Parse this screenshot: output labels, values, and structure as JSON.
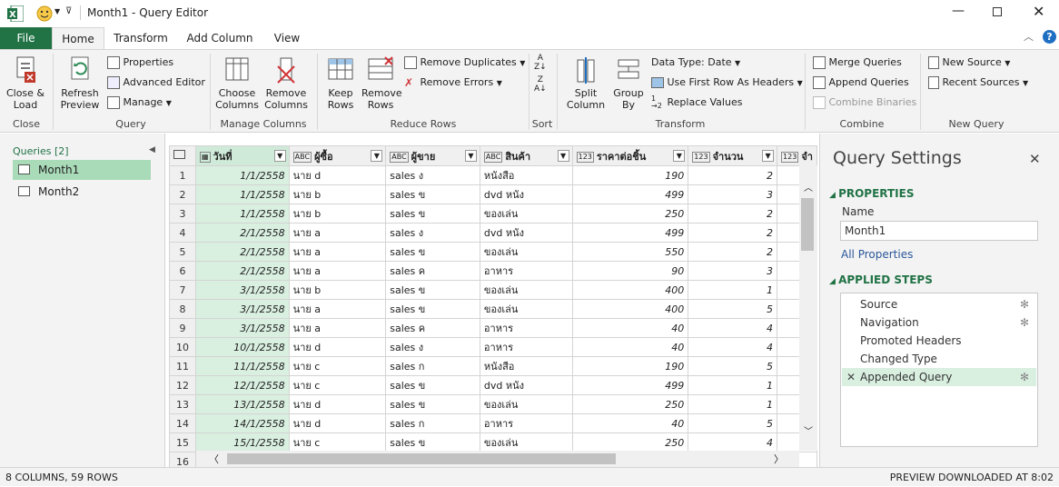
{
  "window": {
    "title": "Month1 - Query Editor",
    "app_icon": "excel-icon",
    "quick_access": "smiley-icon",
    "controls": [
      "minimize",
      "maximize",
      "close"
    ]
  },
  "ribbon_tabs": [
    "File",
    "Home",
    "Transform",
    "Add Column",
    "View"
  ],
  "ribbon": {
    "close": {
      "btn": "Close &\nLoad",
      "label": "Close"
    },
    "query": {
      "refresh": "Refresh\nPreview",
      "properties": "Properties",
      "advanced": "Advanced Editor",
      "manage": "Manage",
      "label": "Query"
    },
    "manage_columns": {
      "choose": "Choose\nColumns",
      "remove": "Remove\nColumns",
      "label": "Manage Columns"
    },
    "reduce_rows": {
      "keep": "Keep\nRows",
      "remove": "Remove\nRows",
      "dup": "Remove Duplicates",
      "errors": "Remove Errors",
      "label": "Reduce Rows"
    },
    "sort": {
      "label": "Sort"
    },
    "transform": {
      "split": "Split\nColumn",
      "group": "Group\nBy",
      "datatype": "Data Type: Date",
      "firstrow": "Use First Row As Headers",
      "replace": "Replace Values",
      "label": "Transform"
    },
    "combine": {
      "merge": "Merge Queries",
      "append": "Append Queries",
      "binaries": "Combine Binaries",
      "label": "Combine"
    },
    "new_query": {
      "newsrc": "New Source",
      "recent": "Recent Sources",
      "label": "New Query"
    }
  },
  "queries": {
    "header": "Queries [2]",
    "items": [
      "Month1",
      "Month2"
    ]
  },
  "grid": {
    "columns": [
      {
        "type": "date",
        "name": "วันที่"
      },
      {
        "type": "ABC",
        "name": "ผู้ซื้อ"
      },
      {
        "type": "ABC",
        "name": "ผู้ขาย"
      },
      {
        "type": "ABC",
        "name": "สินค้า"
      },
      {
        "type": "123",
        "name": "ราคาต่อชิ้น"
      },
      {
        "type": "123",
        "name": "จำนวน"
      },
      {
        "type": "123",
        "name": "จำ"
      }
    ],
    "rows": [
      [
        "1",
        "1/1/2558",
        "นาย d",
        "sales ง",
        "หนังสือ",
        "190",
        "2"
      ],
      [
        "2",
        "1/1/2558",
        "นาย b",
        "sales ข",
        "dvd หนัง",
        "499",
        "3"
      ],
      [
        "3",
        "1/1/2558",
        "นาย b",
        "sales ข",
        "ของเล่น",
        "250",
        "2"
      ],
      [
        "4",
        "2/1/2558",
        "นาย a",
        "sales ง",
        "dvd หนัง",
        "499",
        "2"
      ],
      [
        "5",
        "2/1/2558",
        "นาย a",
        "sales ข",
        "ของเล่น",
        "550",
        "2"
      ],
      [
        "6",
        "2/1/2558",
        "นาย a",
        "sales ค",
        "อาหาร",
        "90",
        "3"
      ],
      [
        "7",
        "3/1/2558",
        "นาย b",
        "sales ข",
        "ของเล่น",
        "400",
        "1"
      ],
      [
        "8",
        "3/1/2558",
        "นาย a",
        "sales ข",
        "ของเล่น",
        "400",
        "5"
      ],
      [
        "9",
        "3/1/2558",
        "นาย a",
        "sales ค",
        "อาหาร",
        "40",
        "4"
      ],
      [
        "10",
        "10/1/2558",
        "นาย d",
        "sales ง",
        "อาหาร",
        "40",
        "4"
      ],
      [
        "11",
        "11/1/2558",
        "นาย c",
        "sales ก",
        "หนังสือ",
        "190",
        "5"
      ],
      [
        "12",
        "12/1/2558",
        "นาย c",
        "sales ข",
        "dvd หนัง",
        "499",
        "1"
      ],
      [
        "13",
        "13/1/2558",
        "นาย d",
        "sales ข",
        "ของเล่น",
        "250",
        "1"
      ],
      [
        "14",
        "14/1/2558",
        "นาย d",
        "sales ก",
        "อาหาร",
        "40",
        "5"
      ],
      [
        "15",
        "15/1/2558",
        "นาย c",
        "sales ข",
        "ของเล่น",
        "250",
        "4"
      ],
      [
        "16",
        "",
        "",
        "",
        "",
        "",
        ""
      ]
    ]
  },
  "settings": {
    "title": "Query Settings",
    "properties": "PROPERTIES",
    "name_label": "Name",
    "name_value": "Month1",
    "all_props": "All Properties",
    "applied_steps": "APPLIED STEPS",
    "steps": [
      "Source",
      "Navigation",
      "Promoted Headers",
      "Changed Type",
      "Appended Query"
    ]
  },
  "status": {
    "left": "8 COLUMNS, 59 ROWS",
    "right": "PREVIEW DOWNLOADED AT 8:02"
  },
  "colors": {
    "accent": "#217346",
    "selected": "#a9dbb9",
    "link": "#2b579a"
  }
}
